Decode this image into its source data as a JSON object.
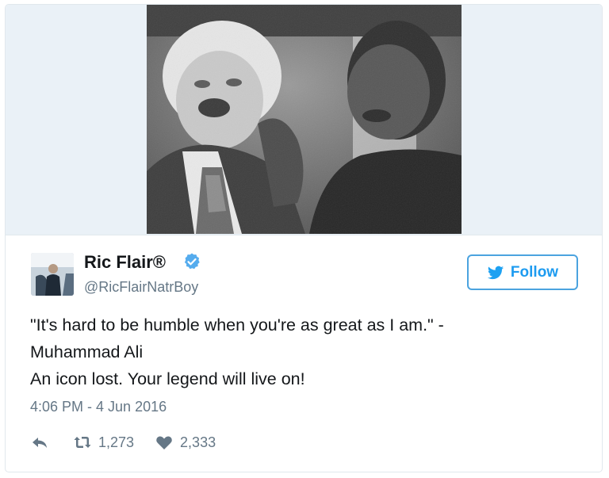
{
  "tweet": {
    "author": {
      "display_name": "Ric Flair®",
      "handle": "@RicFlairNatrBoy",
      "verified": true
    },
    "follow_label": "Follow",
    "text_lines": [
      "\"It's hard to be humble when you're as great as I am.\" -",
      "Muhammad Ali",
      "An icon lost. Your legend will live on!"
    ],
    "timestamp": "4:06 PM - 4 Jun 2016",
    "retweets": "1,273",
    "likes": "2,333"
  },
  "colors": {
    "accent": "#1da1f2",
    "text_primary": "#14171a",
    "text_secondary": "#657786"
  }
}
